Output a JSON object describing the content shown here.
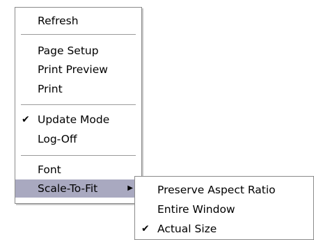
{
  "context_menu": {
    "items": [
      {
        "label": "Refresh"
      },
      {
        "label": "Page Setup"
      },
      {
        "label": "Print Preview"
      },
      {
        "label": "Print"
      },
      {
        "label": "Update Mode",
        "checked": true
      },
      {
        "label": "Log-Off"
      },
      {
        "label": "Font"
      },
      {
        "label": "Scale-To-Fit",
        "highlighted": true,
        "has_submenu": true
      }
    ],
    "check_glyph": "✔",
    "submenu_arrow_glyph": "▶",
    "highlight_color": "#a9a9c0"
  },
  "submenu": {
    "items": [
      {
        "label": "Preserve Aspect Ratio"
      },
      {
        "label": "Entire Window"
      },
      {
        "label": "Actual Size",
        "checked": true
      }
    ]
  }
}
